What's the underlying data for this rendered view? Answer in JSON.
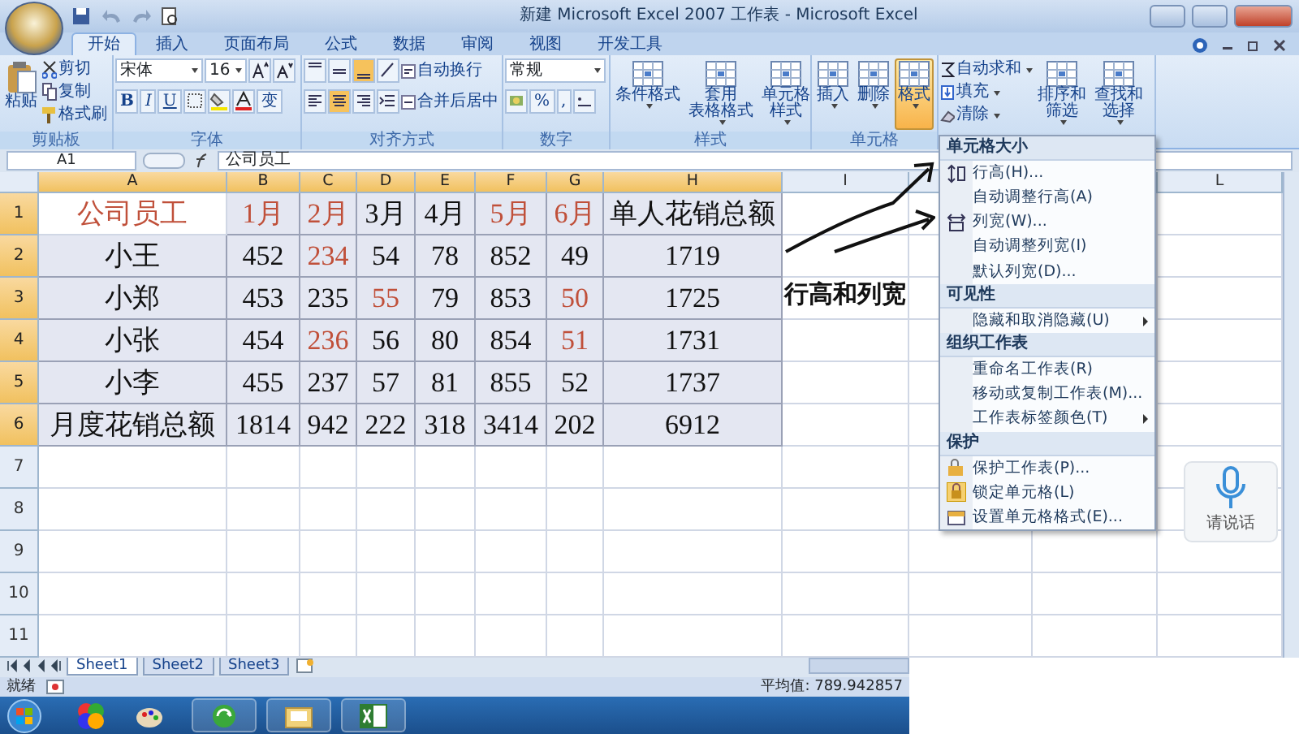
{
  "window": {
    "title": "新建 Microsoft Excel 2007 工作表 - Microsoft Excel"
  },
  "tabs": [
    {
      "label": "开始",
      "selected": true
    },
    {
      "label": "插入",
      "selected": false
    },
    {
      "label": "页面布局",
      "selected": false
    },
    {
      "label": "公式",
      "selected": false
    },
    {
      "label": "数据",
      "selected": false
    },
    {
      "label": "审阅",
      "selected": false
    },
    {
      "label": "视图",
      "selected": false
    },
    {
      "label": "开发工具",
      "selected": false
    }
  ],
  "ribbon": [
    {
      "kind": "clipboard",
      "label": "剪贴板",
      "large": "粘贴",
      "items": [
        "剪切",
        "复制",
        "格式刷"
      ]
    },
    {
      "kind": "font",
      "label": "字体",
      "font": "宋体",
      "size": "16",
      "styles": [
        "B",
        "I",
        "U"
      ],
      "phonetic": "变"
    },
    {
      "kind": "alignment",
      "label": "对齐方式",
      "items": [
        "自动换行",
        "合并后居中"
      ]
    },
    {
      "kind": "number",
      "label": "数字",
      "format": "常规",
      "symbols": [
        "%",
        ","
      ]
    },
    {
      "kind": "large",
      "label": "样式",
      "buttons": [
        {
          "lines": [
            "条件格式"
          ],
          "selected": false
        },
        {
          "lines": [
            "套用",
            "表格格式"
          ],
          "selected": false
        },
        {
          "lines": [
            "单元格",
            "样式"
          ],
          "selected": false
        }
      ]
    },
    {
      "kind": "large",
      "label": "单元格",
      "buttons": [
        {
          "lines": [
            "插入"
          ],
          "selected": false
        },
        {
          "lines": [
            "删除"
          ],
          "selected": false
        },
        {
          "lines": [
            "格式"
          ],
          "selected": true
        }
      ]
    },
    {
      "kind": "editing",
      "items": [
        "自动求和",
        "填充",
        "清除"
      ],
      "buttons": [
        {
          "lines": [
            "排序和",
            "筛选"
          ],
          "selected": false
        },
        {
          "lines": [
            "查找和",
            "选择"
          ],
          "selected": false
        }
      ]
    }
  ],
  "formula_bar": {
    "name_box": "A1",
    "value": "公司员工"
  },
  "columns": [
    {
      "label": "A",
      "selected": true
    },
    {
      "label": "B",
      "selected": true
    },
    {
      "label": "C",
      "selected": true
    },
    {
      "label": "D",
      "selected": true
    },
    {
      "label": "E",
      "selected": true
    },
    {
      "label": "F",
      "selected": true
    },
    {
      "label": "G",
      "selected": true
    },
    {
      "label": "H",
      "selected": true
    },
    {
      "label": "I",
      "selected": false
    },
    {
      "label": "L",
      "selected": false
    }
  ],
  "row_headers": [
    {
      "label": "1",
      "selected": true
    },
    {
      "label": "2",
      "selected": true
    },
    {
      "label": "3",
      "selected": true
    },
    {
      "label": "4",
      "selected": true
    },
    {
      "label": "5",
      "selected": true
    },
    {
      "label": "6",
      "selected": true
    },
    {
      "label": "7",
      "selected": false
    },
    {
      "label": "8",
      "selected": false
    },
    {
      "label": "9",
      "selected": false
    },
    {
      "label": "10",
      "selected": false
    },
    {
      "label": "11",
      "selected": false
    }
  ],
  "cells": [
    [
      {
        "text": "公司员工",
        "highlighted": true,
        "selected": false
      },
      {
        "text": "1月",
        "highlighted": true,
        "selected": true
      },
      {
        "text": "2月",
        "highlighted": true,
        "selected": true
      },
      {
        "text": "3月",
        "highlighted": false,
        "selected": true
      },
      {
        "text": "4月",
        "highlighted": false,
        "selected": true
      },
      {
        "text": "5月",
        "highlighted": true,
        "selected": true
      },
      {
        "text": "6月",
        "highlighted": true,
        "selected": true
      },
      {
        "text": "单人花销总额",
        "highlighted": false,
        "selected": true
      }
    ],
    [
      {
        "text": "小王",
        "highlighted": false,
        "selected": true
      },
      {
        "text": "452",
        "highlighted": false,
        "selected": true
      },
      {
        "text": "234",
        "highlighted": true,
        "selected": true
      },
      {
        "text": "54",
        "highlighted": false,
        "selected": true
      },
      {
        "text": "78",
        "highlighted": false,
        "selected": true
      },
      {
        "text": "852",
        "highlighted": false,
        "selected": true
      },
      {
        "text": "49",
        "highlighted": false,
        "selected": true
      },
      {
        "text": "1719",
        "highlighted": false,
        "selected": true
      }
    ],
    [
      {
        "text": "小郑",
        "highlighted": false,
        "selected": true
      },
      {
        "text": "453",
        "highlighted": false,
        "selected": true
      },
      {
        "text": "235",
        "highlighted": false,
        "selected": true
      },
      {
        "text": "55",
        "highlighted": true,
        "selected": true
      },
      {
        "text": "79",
        "highlighted": false,
        "selected": true
      },
      {
        "text": "853",
        "highlighted": false,
        "selected": true
      },
      {
        "text": "50",
        "highlighted": true,
        "selected": true
      },
      {
        "text": "1725",
        "highlighted": false,
        "selected": true
      }
    ],
    [
      {
        "text": "小张",
        "highlighted": false,
        "selected": true
      },
      {
        "text": "454",
        "highlighted": false,
        "selected": true
      },
      {
        "text": "236",
        "highlighted": true,
        "selected": true
      },
      {
        "text": "56",
        "highlighted": false,
        "selected": true
      },
      {
        "text": "80",
        "highlighted": false,
        "selected": true
      },
      {
        "text": "854",
        "highlighted": false,
        "selected": true
      },
      {
        "text": "51",
        "highlighted": true,
        "selected": true
      },
      {
        "text": "1731",
        "highlighted": false,
        "selected": true
      }
    ],
    [
      {
        "text": "小李",
        "highlighted": false,
        "selected": true
      },
      {
        "text": "455",
        "highlighted": false,
        "selected": true
      },
      {
        "text": "237",
        "highlighted": false,
        "selected": true
      },
      {
        "text": "57",
        "highlighted": false,
        "selected": true
      },
      {
        "text": "81",
        "highlighted": false,
        "selected": true
      },
      {
        "text": "855",
        "highlighted": false,
        "selected": true
      },
      {
        "text": "52",
        "highlighted": false,
        "selected": true
      },
      {
        "text": "1737",
        "highlighted": false,
        "selected": true
      }
    ],
    [
      {
        "text": "月度花销总额",
        "highlighted": false,
        "selected": true
      },
      {
        "text": "1814",
        "highlighted": false,
        "selected": true
      },
      {
        "text": "942",
        "highlighted": false,
        "selected": true
      },
      {
        "text": "222",
        "highlighted": false,
        "selected": true
      },
      {
        "text": "318",
        "highlighted": false,
        "selected": true
      },
      {
        "text": "3414",
        "highlighted": false,
        "selected": true
      },
      {
        "text": "202",
        "highlighted": false,
        "selected": true
      },
      {
        "text": "6912",
        "highlighted": false,
        "selected": true
      }
    ]
  ],
  "annotation": {
    "text": "行高和列宽"
  },
  "format_menu": {
    "sections": [
      {
        "header": "单元格大小",
        "items": [
          {
            "label": "行高(H)...",
            "kind": "rowheight",
            "submenu": false
          },
          {
            "label": "自动调整行高(A)",
            "kind": "plain",
            "submenu": false
          },
          {
            "label": "列宽(W)...",
            "kind": "colwidth",
            "submenu": false
          },
          {
            "label": "自动调整列宽(I)",
            "kind": "plain",
            "submenu": false
          },
          {
            "label": "默认列宽(D)...",
            "kind": "plain",
            "submenu": false
          }
        ]
      },
      {
        "header": "可见性",
        "items": [
          {
            "label": "隐藏和取消隐藏(U)",
            "kind": "plain",
            "submenu": true
          }
        ]
      },
      {
        "header": "组织工作表",
        "items": [
          {
            "label": "重命名工作表(R)",
            "kind": "plain",
            "submenu": false
          },
          {
            "label": "移动或复制工作表(M)...",
            "kind": "plain",
            "submenu": false
          },
          {
            "label": "工作表标签颜色(T)",
            "kind": "plain",
            "submenu": true
          }
        ]
      },
      {
        "header": "保护",
        "items": [
          {
            "label": "保护工作表(P)...",
            "kind": "protect",
            "submenu": false
          },
          {
            "label": "锁定单元格(L)",
            "kind": "lock",
            "submenu": false
          },
          {
            "label": "设置单元格格式(E)...",
            "kind": "format",
            "submenu": false
          }
        ]
      }
    ]
  },
  "voice_button": {
    "label": "请说话"
  },
  "sheet_tabs": [
    {
      "label": "Sheet1",
      "selected": true
    },
    {
      "label": "Sheet2",
      "selected": false
    },
    {
      "label": "Sheet3",
      "selected": false
    }
  ],
  "status_bar": {
    "state": "就绪",
    "average": "平均值: 789.942857"
  }
}
